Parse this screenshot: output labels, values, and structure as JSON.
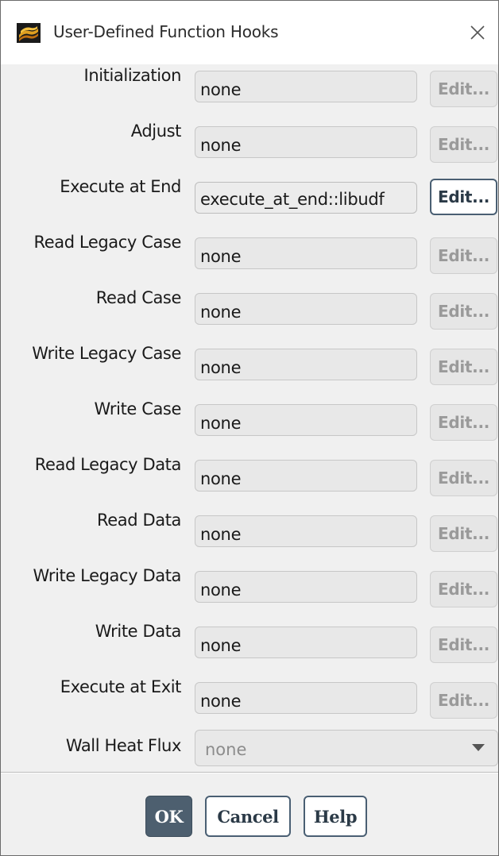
{
  "window": {
    "title": "User-Defined Function Hooks",
    "app_icon": "ansys-fluent-icon",
    "close_icon": "close-icon"
  },
  "hooks": [
    {
      "label": "Initialization",
      "value": "none",
      "edit": "Edit...",
      "enabled": false
    },
    {
      "label": "Adjust",
      "value": "none",
      "edit": "Edit...",
      "enabled": false
    },
    {
      "label": "Execute at End",
      "value": "execute_at_end::libudf",
      "edit": "Edit...",
      "enabled": true
    },
    {
      "label": "Read Legacy Case",
      "value": "none",
      "edit": "Edit...",
      "enabled": false
    },
    {
      "label": "Read Case",
      "value": "none",
      "edit": "Edit...",
      "enabled": false
    },
    {
      "label": "Write Legacy Case",
      "value": "none",
      "edit": "Edit...",
      "enabled": false
    },
    {
      "label": "Write Case",
      "value": "none",
      "edit": "Edit...",
      "enabled": false
    },
    {
      "label": "Read Legacy Data",
      "value": "none",
      "edit": "Edit...",
      "enabled": false
    },
    {
      "label": "Read Data",
      "value": "none",
      "edit": "Edit...",
      "enabled": false
    },
    {
      "label": "Write Legacy Data",
      "value": "none",
      "edit": "Edit...",
      "enabled": false
    },
    {
      "label": "Write Data",
      "value": "none",
      "edit": "Edit...",
      "enabled": false
    },
    {
      "label": "Execute at Exit",
      "value": "none",
      "edit": "Edit...",
      "enabled": false
    }
  ],
  "wall_heat_flux": {
    "label": "Wall Heat Flux",
    "value": "none"
  },
  "buttons": {
    "ok": "OK",
    "cancel": "Cancel",
    "help": "Help"
  },
  "colors": {
    "accent": "#4d5f6f",
    "disabled_text": "#9a9a9a"
  }
}
